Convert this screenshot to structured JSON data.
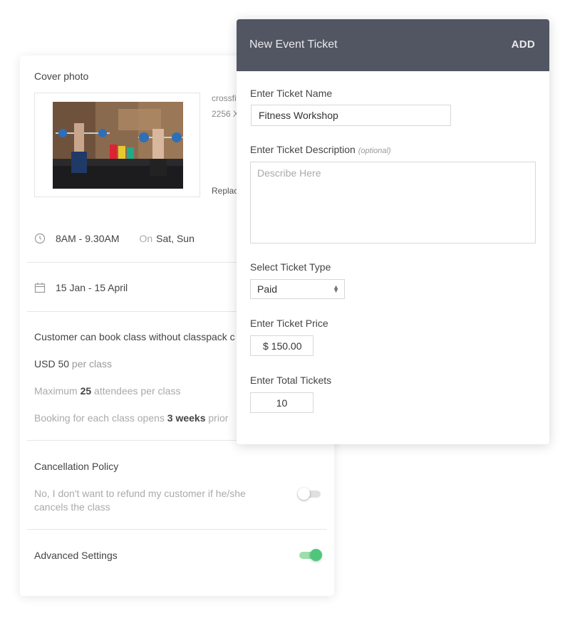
{
  "settings": {
    "cover_label": "Cover photo",
    "photo_filename": "crossfit",
    "photo_size": "2256 X",
    "replace_label": "Replac",
    "time": "8AM - 9.30AM",
    "on_label": "On",
    "days": "Sat, Sun",
    "date_range": "15 Jan - 15 April",
    "booking_title": "Customer can book class without classpack c",
    "price_currency": "USD",
    "price_value": "50",
    "price_unit": "per class",
    "max_prefix": "Maximum",
    "max_value": "25",
    "max_suffix": "attendees per class",
    "opens_prefix": "Booking for each class opens",
    "opens_value": "3 weeks",
    "opens_suffix": "prior",
    "cancellation_title": "Cancellation Policy",
    "cancellation_desc_line1": "No, I don't want to refund my customer if he/she",
    "cancellation_desc_line2": "cancels the class",
    "cancellation_enabled": false,
    "advanced_title": "Advanced Settings",
    "advanced_enabled": true
  },
  "ticket_modal": {
    "title": "New Event Ticket",
    "add_label": "ADD",
    "name_label": "Enter Ticket Name",
    "name_value": "Fitness Workshop",
    "desc_label": "Enter Ticket Description",
    "desc_optional": "(optional)",
    "desc_placeholder": "Describe Here",
    "type_label": "Select Ticket Type",
    "type_value": "Paid",
    "price_label": "Enter Ticket Price",
    "price_value": "$ 150.00",
    "total_label": "Enter Total Tickets",
    "total_value": "10"
  },
  "colors": {
    "header_bg": "#525663",
    "toggle_on": "#4ec77a"
  }
}
